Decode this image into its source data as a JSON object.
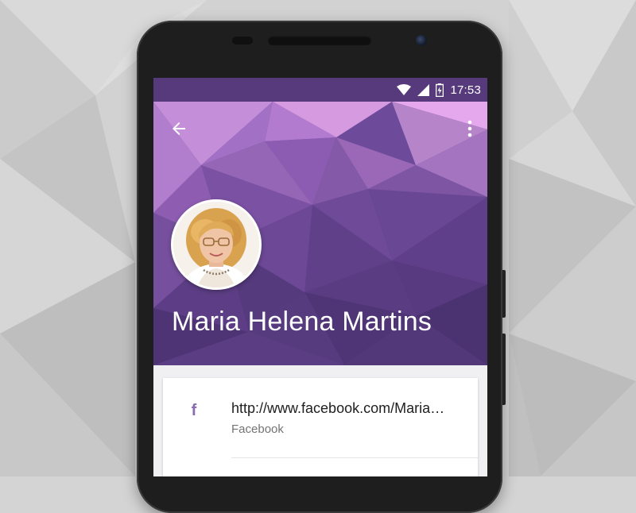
{
  "status_bar": {
    "time": "17:53",
    "icons": [
      "wifi-icon",
      "cell-signal-icon",
      "battery-charging-icon"
    ]
  },
  "toolbar": {
    "back_icon": "arrow-back-icon",
    "menu_icon": "more-vert-icon"
  },
  "contact": {
    "name": "Maria Helena Martins",
    "avatar": "profile-photo",
    "details": [
      {
        "icon": "facebook-icon",
        "icon_glyph": "f",
        "value": "http://www.facebook.com/Maria…",
        "label": "Facebook"
      }
    ]
  },
  "colors": {
    "accent": "#8a6bb1",
    "header_primary": "#7a4fa8",
    "status_overlay": "#5a3c82",
    "card_background": "#ffffff",
    "screen_background": "#f0eff1"
  }
}
